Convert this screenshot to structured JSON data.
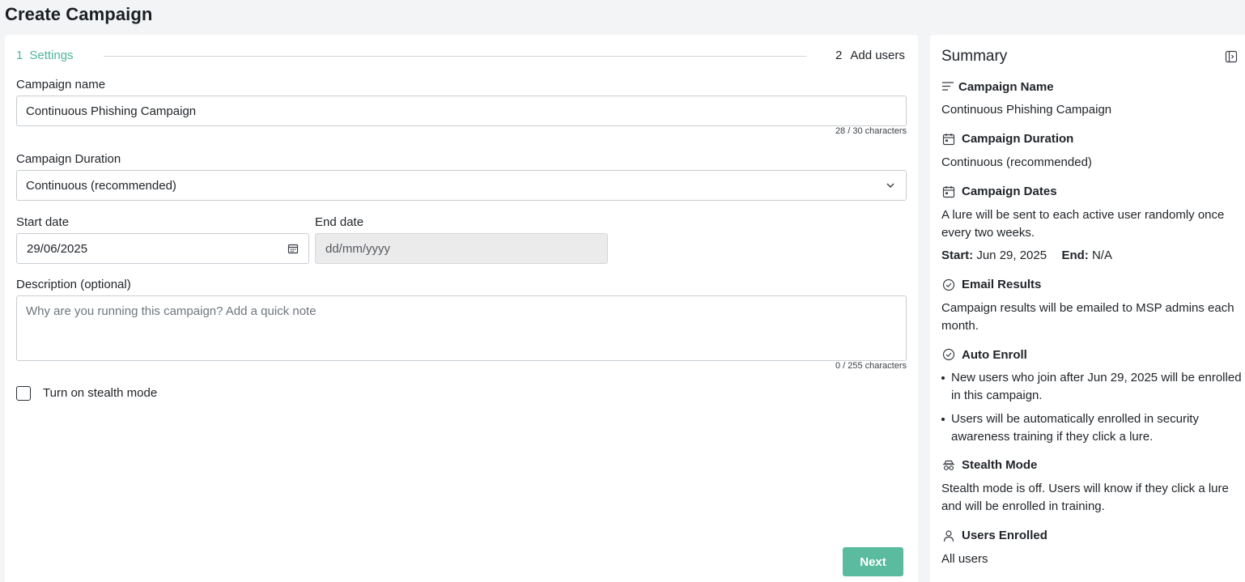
{
  "page": {
    "title": "Create Campaign"
  },
  "stepper": {
    "step1": {
      "number": "1",
      "label": "Settings"
    },
    "step2": {
      "number": "2",
      "label": "Add users"
    }
  },
  "form": {
    "campaign_name": {
      "label": "Campaign name",
      "value": "Continuous Phishing Campaign",
      "counter": "28 / 30 characters"
    },
    "duration": {
      "label": "Campaign Duration",
      "value": "Continuous (recommended)"
    },
    "start_date": {
      "label": "Start date",
      "value": "29/06/2025"
    },
    "end_date": {
      "label": "End date",
      "placeholder": "dd/mm/yyyy"
    },
    "description": {
      "label": "Description (optional)",
      "placeholder": "Why are you running this campaign? Add a quick note",
      "counter": "0 / 255 characters"
    },
    "stealth": {
      "label": "Turn on stealth mode",
      "checked": false
    },
    "next_label": "Next"
  },
  "summary": {
    "title": "Summary",
    "campaign_name": {
      "heading": "Campaign Name",
      "icon": "lines-icon",
      "text": "Continuous Phishing Campaign"
    },
    "campaign_duration": {
      "heading": "Campaign Duration",
      "icon": "calendar-icon",
      "text": "Continuous (recommended)"
    },
    "campaign_dates": {
      "heading": "Campaign Dates",
      "icon": "calendar-icon",
      "text": "A lure will be sent to each active user randomly once every two weeks.",
      "start_label": "Start:",
      "start_value": "Jun 29, 2025",
      "end_label": "End:",
      "end_value": "N/A"
    },
    "email_results": {
      "heading": "Email Results",
      "icon": "check-circle-icon",
      "text": "Campaign results will be emailed to MSP admins each month."
    },
    "auto_enroll": {
      "heading": "Auto Enroll",
      "icon": "check-circle-icon",
      "bullets": [
        "New users who join after Jun 29, 2025 will be enrolled in this campaign.",
        "Users will be automatically enrolled in security awareness training if they click a lure."
      ]
    },
    "stealth_mode": {
      "heading": "Stealth Mode",
      "icon": "incognito-icon",
      "text": "Stealth mode is off. Users will know if they click a lure and will be enrolled in training."
    },
    "users_enrolled": {
      "heading": "Users Enrolled",
      "icon": "user-icon",
      "text": "All users"
    }
  },
  "colors": {
    "accent": "#5bbb9e",
    "step_active": "#4fb69b",
    "background": "#f3f4f6"
  }
}
